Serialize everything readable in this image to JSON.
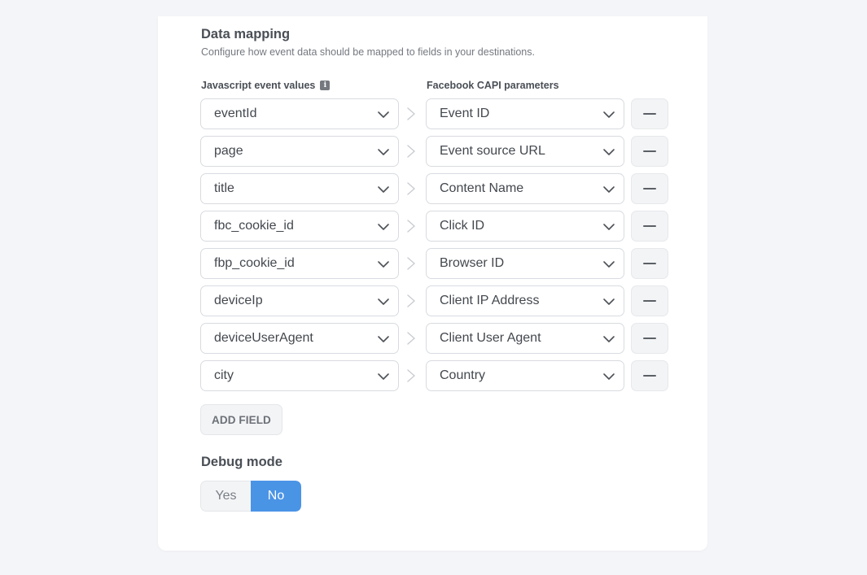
{
  "section": {
    "title": "Data mapping",
    "description": "Configure how event data should be mapped to fields in your destinations."
  },
  "columns": {
    "left_header": "Javascript event values",
    "left_icon": "info-icon",
    "right_header": "Facebook CAPI parameters"
  },
  "mappings": [
    {
      "source": "eventId",
      "target": "Event ID"
    },
    {
      "source": "page",
      "target": "Event source URL"
    },
    {
      "source": "title",
      "target": "Content Name"
    },
    {
      "source": "fbc_cookie_id",
      "target": "Click ID"
    },
    {
      "source": "fbp_cookie_id",
      "target": "Browser ID"
    },
    {
      "source": "deviceIp",
      "target": "Client IP Address"
    },
    {
      "source": "deviceUserAgent",
      "target": "Client User Agent"
    },
    {
      "source": "city",
      "target": "Country"
    }
  ],
  "add_field_label": "ADD FIELD",
  "debug": {
    "title": "Debug mode",
    "yes_label": "Yes",
    "no_label": "No",
    "selected": "No"
  },
  "colors": {
    "accent": "#4a94e6",
    "background": "#f4f5f8",
    "card": "#ffffff"
  }
}
